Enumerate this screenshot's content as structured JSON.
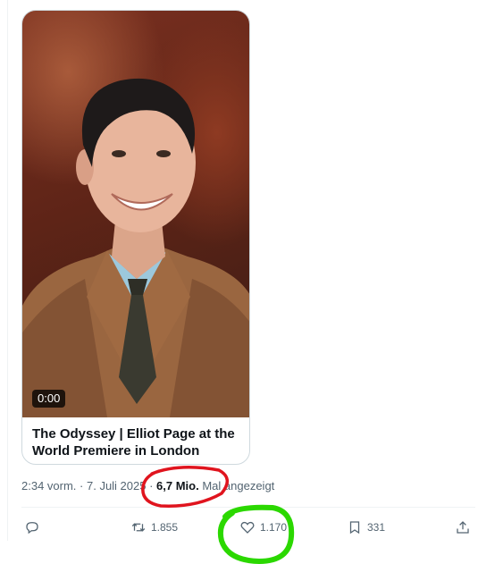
{
  "media": {
    "duration": "0:00",
    "title": "The Odyssey | Elliot Page at the World Premiere in London"
  },
  "meta": {
    "time": "2:34 vorm.",
    "sep1": " · ",
    "date": "7. Juli 2025",
    "sep2": " · ",
    "views": "6,7 Mio.",
    "views_suffix": " Mal angezeigt"
  },
  "actions": {
    "reply": {
      "icon": "reply-icon",
      "count": ""
    },
    "repost": {
      "icon": "repost-icon",
      "count": "1.855"
    },
    "like": {
      "icon": "heart-icon",
      "count": "1.170"
    },
    "bookmark": {
      "icon": "bookmark-icon",
      "count": "331"
    },
    "share": {
      "icon": "share-icon",
      "count": ""
    }
  },
  "annotations": {
    "views_circle_color": "#e0141e",
    "like_circle_color": "#2bd800"
  }
}
